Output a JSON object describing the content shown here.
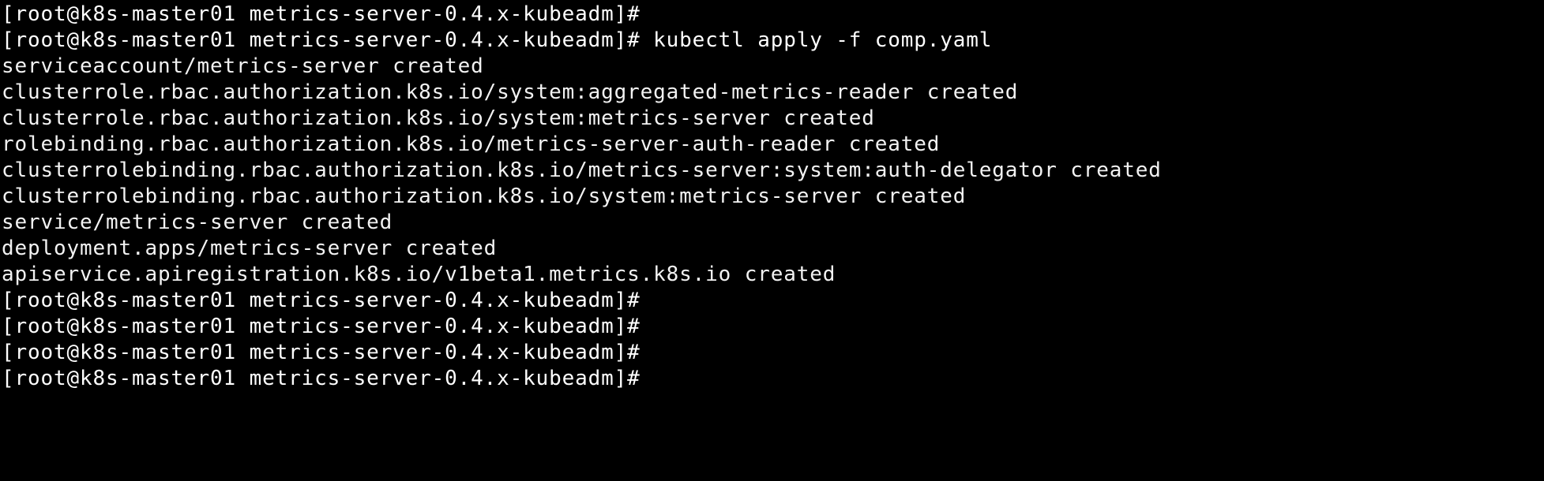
{
  "terminal": {
    "app": "linux-console",
    "background_color": "#000000",
    "foreground_color": "#ffffff",
    "columns_visible": 92,
    "rows_visible": 15,
    "prompt": "[root@k8s-master01 metrics-server-0.4.x-kubeadm]#",
    "user": "root",
    "host": "k8s-master01",
    "cwd": "metrics-server-0.4.x-kubeadm",
    "command": "kubectl apply -f comp.yaml",
    "lines": [
      {
        "kind": "prompt",
        "text": "[root@k8s-master01 metrics-server-0.4.x-kubeadm]# "
      },
      {
        "kind": "prompt",
        "text": "[root@k8s-master01 metrics-server-0.4.x-kubeadm]# kubectl apply -f comp.yaml"
      },
      {
        "kind": "output",
        "text": "serviceaccount/metrics-server created"
      },
      {
        "kind": "output",
        "text": "clusterrole.rbac.authorization.k8s.io/system:aggregated-metrics-reader created"
      },
      {
        "kind": "output",
        "text": "clusterrole.rbac.authorization.k8s.io/system:metrics-server created"
      },
      {
        "kind": "output",
        "text": "rolebinding.rbac.authorization.k8s.io/metrics-server-auth-reader created"
      },
      {
        "kind": "output",
        "text": "clusterrolebinding.rbac.authorization.k8s.io/metrics-server:system:auth-delegator created"
      },
      {
        "kind": "output",
        "text": "clusterrolebinding.rbac.authorization.k8s.io/system:metrics-server created"
      },
      {
        "kind": "output",
        "text": "service/metrics-server created"
      },
      {
        "kind": "output",
        "text": "deployment.apps/metrics-server created"
      },
      {
        "kind": "output",
        "text": "apiservice.apiregistration.k8s.io/v1beta1.metrics.k8s.io created"
      },
      {
        "kind": "prompt",
        "text": "[root@k8s-master01 metrics-server-0.4.x-kubeadm]# "
      },
      {
        "kind": "prompt",
        "text": "[root@k8s-master01 metrics-server-0.4.x-kubeadm]# "
      },
      {
        "kind": "prompt",
        "text": "[root@k8s-master01 metrics-server-0.4.x-kubeadm]# "
      },
      {
        "kind": "prompt",
        "text": "[root@k8s-master01 metrics-server-0.4.x-kubeadm]# "
      }
    ]
  }
}
